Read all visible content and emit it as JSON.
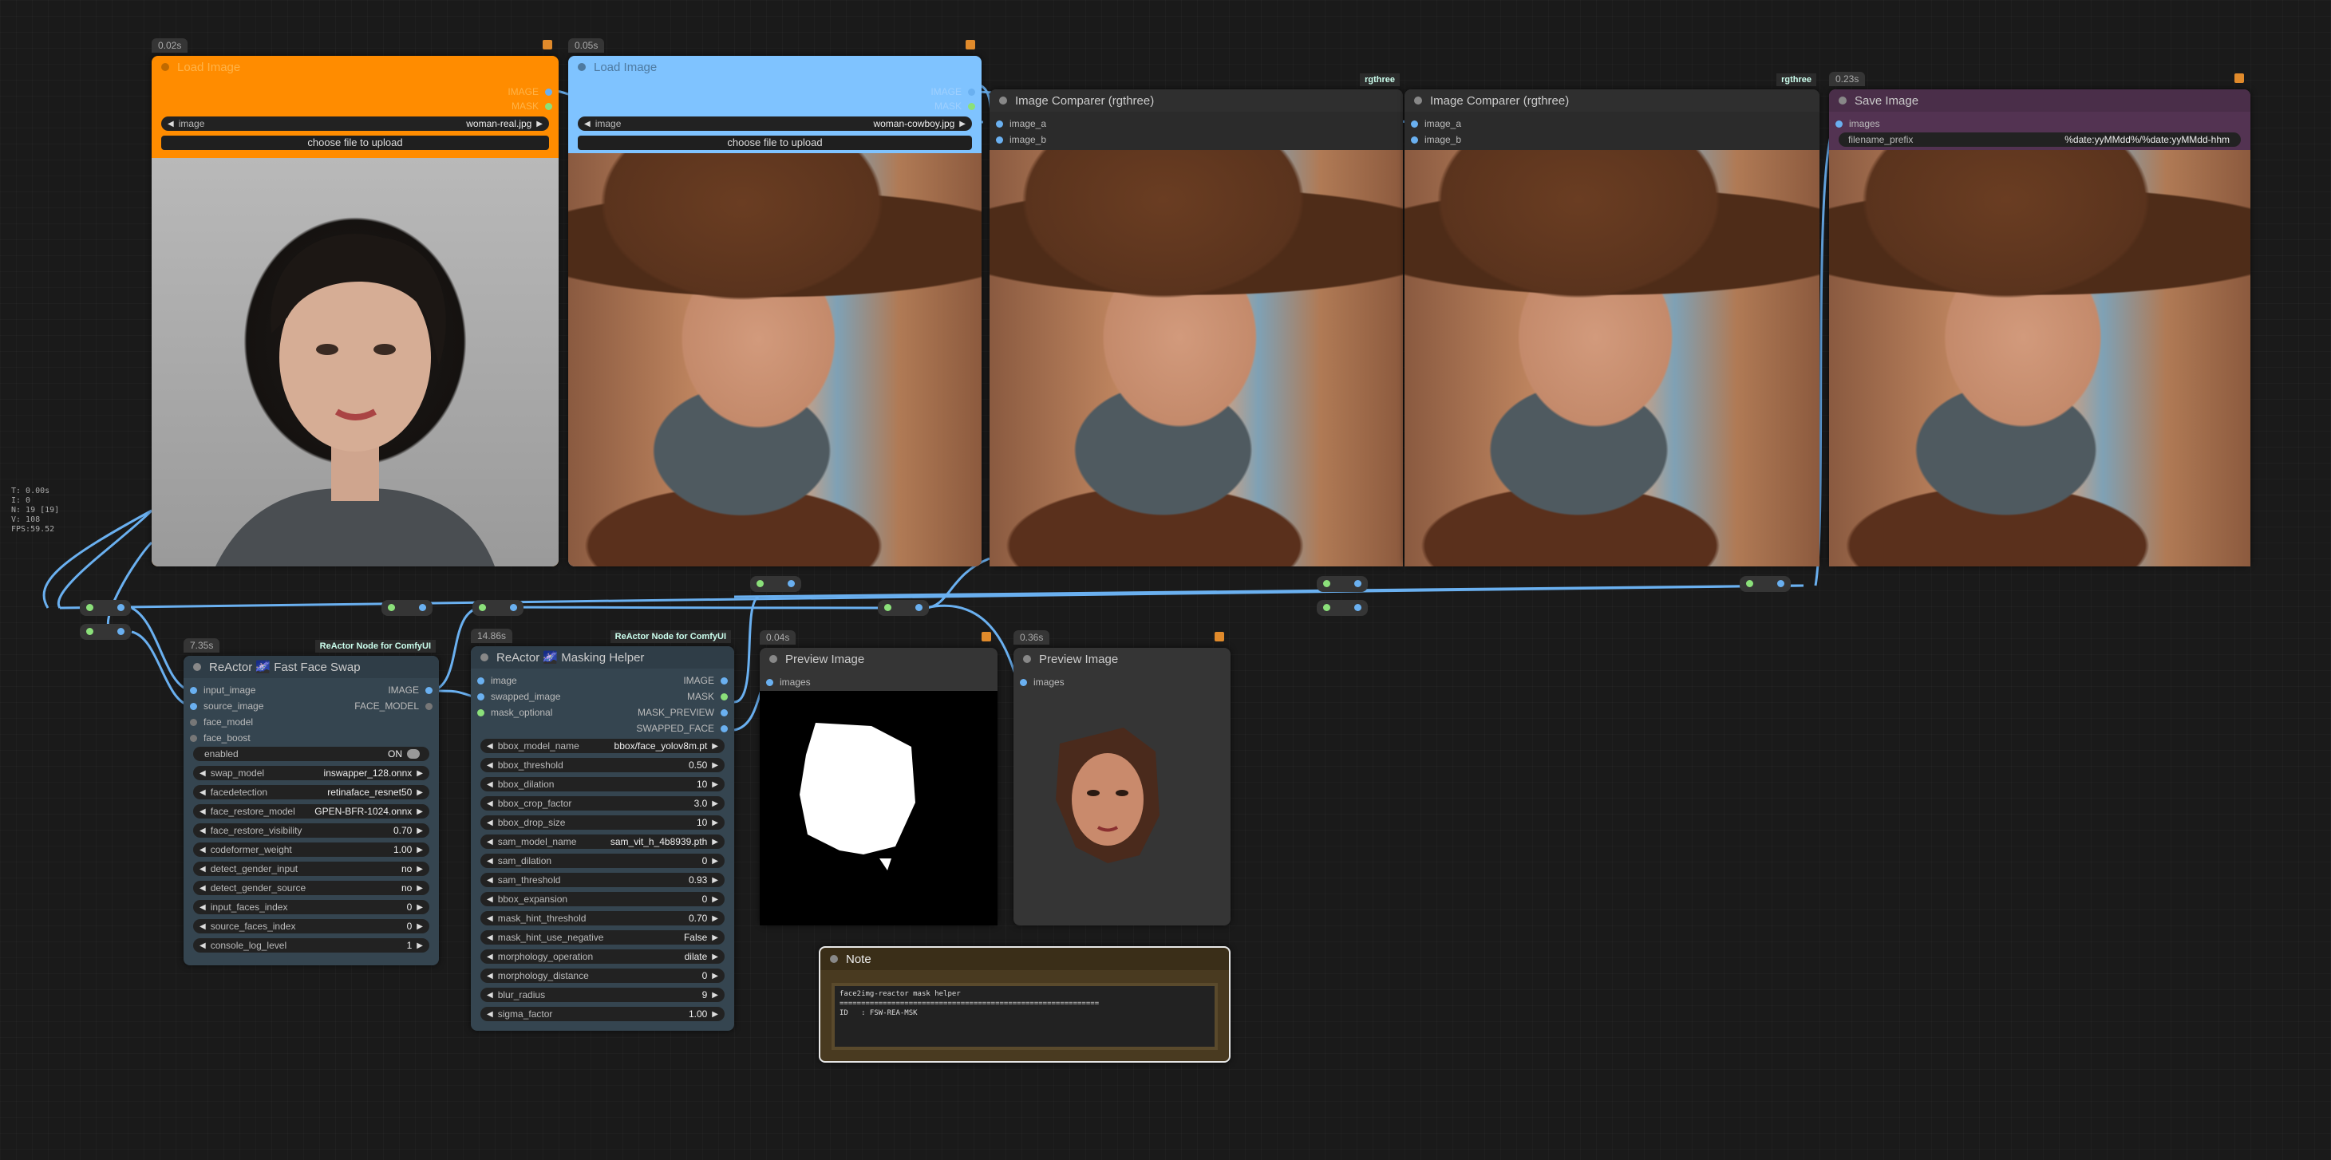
{
  "stats": {
    "t": "T: 0.00s",
    "i": "I: 0",
    "n": "N: 19 [19]",
    "v": "V: 108",
    "fps": "FPS:59.52"
  },
  "load1": {
    "time": "0.02s",
    "title": "Load Image",
    "out_image": "IMAGE",
    "out_mask": "MASK",
    "image_label": "image",
    "image_value": "woman-real.jpg",
    "upload": "choose file to upload"
  },
  "load2": {
    "time": "0.05s",
    "title": "Load Image",
    "out_image": "IMAGE",
    "out_mask": "MASK",
    "image_label": "image",
    "image_value": "woman-cowboy.jpg",
    "upload": "choose file to upload"
  },
  "cmp1": {
    "tag": "rgthree",
    "title": "Image Comparer (rgthree)",
    "in_a": "image_a",
    "in_b": "image_b"
  },
  "cmp2": {
    "tag": "rgthree",
    "title": "Image Comparer (rgthree)",
    "in_a": "image_a",
    "in_b": "image_b"
  },
  "save": {
    "time": "0.23s",
    "title": "Save Image",
    "in_images": "images",
    "prefix_label": "filename_prefix",
    "prefix_value": "%date:yyMMdd%/%date:yyMMdd-hhm"
  },
  "faceswap": {
    "time": "7.35s",
    "tag": "ReActor Node for ComfyUI",
    "title": "ReActor 🌌 Fast Face Swap",
    "inputs": [
      "input_image",
      "source_image",
      "face_model",
      "face_boost"
    ],
    "outputs": [
      "IMAGE",
      "FACE_MODEL"
    ],
    "enabled_label": "enabled",
    "enabled_value": "ON",
    "widgets": [
      {
        "label": "swap_model",
        "value": "inswapper_128.onnx"
      },
      {
        "label": "facedetection",
        "value": "retinaface_resnet50"
      },
      {
        "label": "face_restore_model",
        "value": "GPEN-BFR-1024.onnx"
      },
      {
        "label": "face_restore_visibility",
        "value": "0.70"
      },
      {
        "label": "codeformer_weight",
        "value": "1.00"
      },
      {
        "label": "detect_gender_input",
        "value": "no"
      },
      {
        "label": "detect_gender_source",
        "value": "no"
      },
      {
        "label": "input_faces_index",
        "value": "0"
      },
      {
        "label": "source_faces_index",
        "value": "0"
      },
      {
        "label": "console_log_level",
        "value": "1"
      }
    ]
  },
  "masking": {
    "time": "14.86s",
    "tag": "ReActor Node for ComfyUI",
    "title": "ReActor 🌌 Masking Helper",
    "inputs": [
      "image",
      "swapped_image",
      "mask_optional"
    ],
    "outputs": [
      "IMAGE",
      "MASK",
      "MASK_PREVIEW",
      "SWAPPED_FACE"
    ],
    "widgets": [
      {
        "label": "bbox_model_name",
        "value": "bbox/face_yolov8m.pt"
      },
      {
        "label": "bbox_threshold",
        "value": "0.50"
      },
      {
        "label": "bbox_dilation",
        "value": "10"
      },
      {
        "label": "bbox_crop_factor",
        "value": "3.0"
      },
      {
        "label": "bbox_drop_size",
        "value": "10"
      },
      {
        "label": "sam_model_name",
        "value": "sam_vit_h_4b8939.pth"
      },
      {
        "label": "sam_dilation",
        "value": "0"
      },
      {
        "label": "sam_threshold",
        "value": "0.93"
      },
      {
        "label": "bbox_expansion",
        "value": "0"
      },
      {
        "label": "mask_hint_threshold",
        "value": "0.70"
      },
      {
        "label": "mask_hint_use_negative",
        "value": "False"
      },
      {
        "label": "morphology_operation",
        "value": "dilate"
      },
      {
        "label": "morphology_distance",
        "value": "0"
      },
      {
        "label": "blur_radius",
        "value": "9"
      },
      {
        "label": "sigma_factor",
        "value": "1.00"
      }
    ]
  },
  "preview1": {
    "time": "0.04s",
    "title": "Preview Image",
    "in_images": "images"
  },
  "preview2": {
    "time": "0.36s",
    "title": "Preview Image",
    "in_images": "images"
  },
  "note": {
    "title": "Note",
    "text": "face2img-reactor mask helper\n============================================================\nID   : FSW-REA-MSK"
  },
  "colors": {
    "load1": "#ff8c00",
    "load2": "#7fc3ff",
    "save": "#533352",
    "wire": "#6ab0f0",
    "note": "#493a20"
  }
}
